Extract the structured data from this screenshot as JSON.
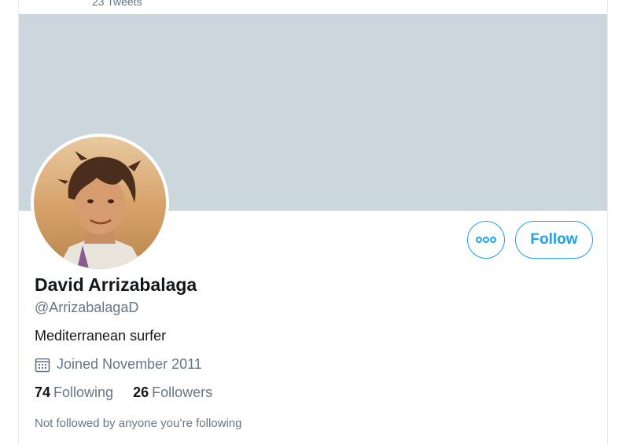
{
  "header": {
    "tweet_count": "23 Tweets"
  },
  "profile": {
    "display_name": "David Arrizabalaga",
    "handle": "@ArrizabalagaD",
    "bio": "Mediterranean surfer",
    "joined": "Joined November 2011",
    "following_count": "74",
    "following_label": "Following",
    "followers_count": "26",
    "followers_label": "Followers",
    "not_followed_text": "Not followed by anyone you’re following"
  },
  "actions": {
    "follow_label": "Follow",
    "more_icon": "more-icon"
  },
  "colors": {
    "accent": "#1da1f2",
    "banner": "#ccd6dd",
    "secondary_text": "#657786",
    "primary_text": "#14171a"
  }
}
